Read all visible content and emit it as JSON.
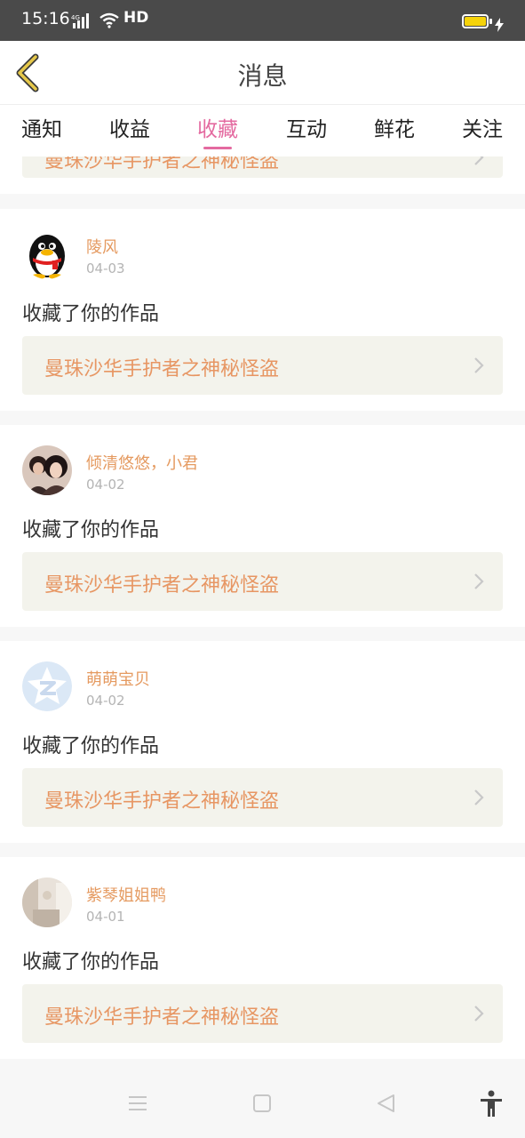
{
  "status_bar": {
    "time": "15:16",
    "network": "4G",
    "hd": "HD",
    "battery_color": "#f6d30a"
  },
  "header": {
    "title": "消息",
    "back_icon": "chevron-left-icon"
  },
  "tabs": [
    {
      "label": "通知",
      "active": false
    },
    {
      "label": "收益",
      "active": false
    },
    {
      "label": "收藏",
      "active": true
    },
    {
      "label": "互动",
      "active": false
    },
    {
      "label": "鲜花",
      "active": false
    },
    {
      "label": "关注",
      "active": false
    }
  ],
  "partial_item": {
    "work_title": "曼珠沙华手护者之神秘怪盗"
  },
  "messages": [
    {
      "user": "陵风",
      "date": "04-03",
      "text": "收藏了你的作品",
      "work": "曼珠沙华手护者之神秘怪盗",
      "avatar": "penguin-avatar"
    },
    {
      "user": "倾清悠悠，小君",
      "date": "04-02",
      "text": "收藏了你的作品",
      "work": "曼珠沙华手护者之神秘怪盗",
      "avatar": "photo-avatar"
    },
    {
      "user": "萌萌宝贝",
      "date": "04-02",
      "text": "收藏了你的作品",
      "work": "曼珠沙华手护者之神秘怪盗",
      "avatar": "qzone-avatar"
    },
    {
      "user": "紫琴姐姐鸭",
      "date": "04-01",
      "text": "收藏了你的作品",
      "work": "曼珠沙华手护者之神秘怪盗",
      "avatar": "photo-avatar"
    }
  ],
  "colors": {
    "accent": "#e46aa0",
    "username": "#e59a60",
    "work_title": "#e79663",
    "work_bg": "#f3f3ec",
    "back_icon": "#e6c84a"
  },
  "nav_bar": {
    "icons": [
      "menu-icon",
      "home-square-icon",
      "back-triangle-icon",
      "accessibility-icon"
    ]
  }
}
